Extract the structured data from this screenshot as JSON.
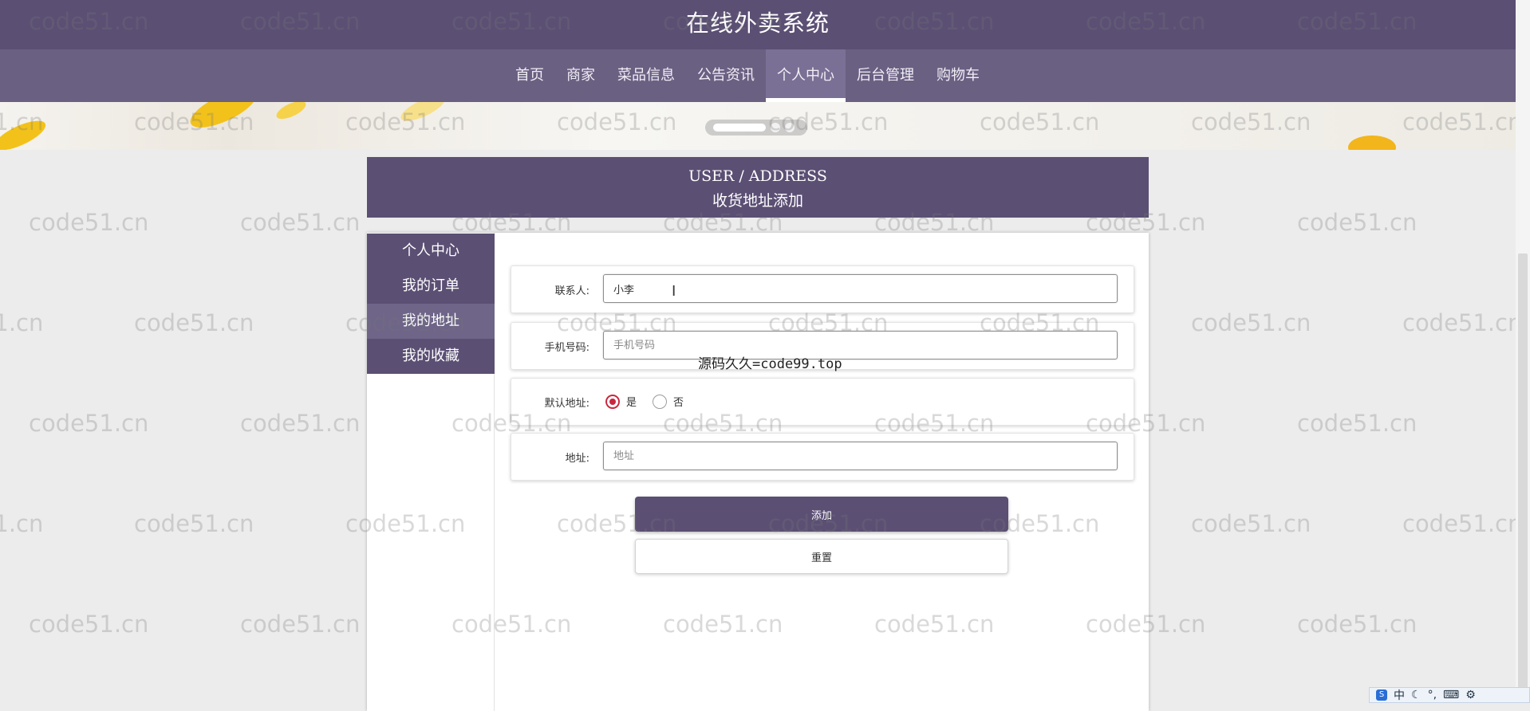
{
  "site": {
    "title": "在线外卖系统"
  },
  "nav": {
    "items": [
      {
        "label": "首页"
      },
      {
        "label": "商家"
      },
      {
        "label": "菜品信息"
      },
      {
        "label": "公告资讯"
      },
      {
        "label": "个人中心",
        "active": true
      },
      {
        "label": "后台管理"
      },
      {
        "label": "购物车"
      }
    ]
  },
  "page_header": {
    "en": "USER / ADDRESS",
    "cn": "收货地址添加"
  },
  "side_menu": {
    "items": [
      {
        "label": "个人中心"
      },
      {
        "label": "我的订单"
      },
      {
        "label": "我的地址",
        "active": true
      },
      {
        "label": "我的收藏"
      }
    ]
  },
  "form": {
    "contact": {
      "label": "联系人:",
      "value": "小李"
    },
    "phone": {
      "label": "手机号码:",
      "placeholder": "手机号码"
    },
    "default_address": {
      "label": "默认地址:",
      "options": [
        {
          "label": "是",
          "checked": true
        },
        {
          "label": "否",
          "checked": false
        }
      ]
    },
    "address": {
      "label": "地址:",
      "placeholder": "地址"
    },
    "submit_label": "添加",
    "reset_label": "重置"
  },
  "watermark": {
    "text": "code51.cn"
  },
  "overlay": {
    "text": "源码久久=code99.top"
  },
  "ime": {
    "mode": "中"
  },
  "colors": {
    "primary": "#5b4f74",
    "radio_checked": "#c8283f",
    "page_bg": "#ececec"
  }
}
